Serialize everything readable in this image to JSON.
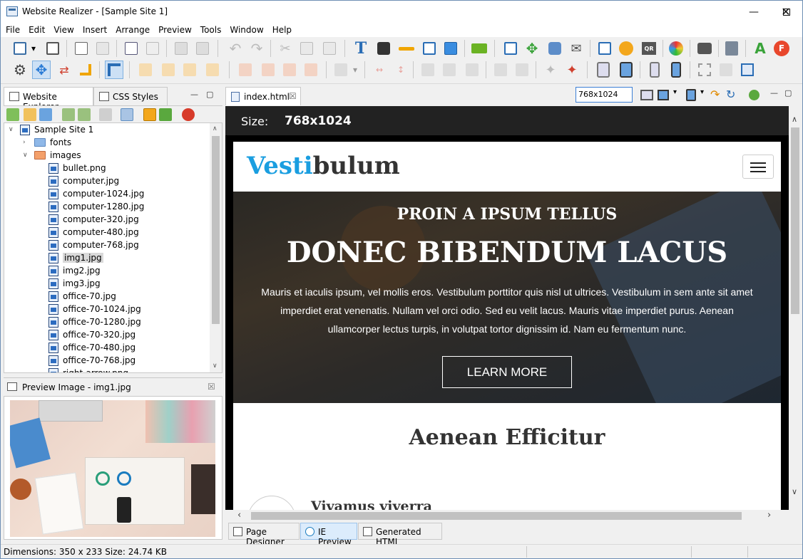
{
  "window": {
    "title": "Website Realizer - [Sample Site 1]"
  },
  "menu": [
    "File",
    "Edit",
    "View",
    "Insert",
    "Arrange",
    "Preview",
    "Tools",
    "Window",
    "Help"
  ],
  "explorer": {
    "tabs": [
      "Website Explorer",
      "CSS Styles"
    ],
    "tree": {
      "root": "Sample Site 1",
      "folders": [
        "fonts",
        "images"
      ],
      "files": [
        "bullet.png",
        "computer.jpg",
        "computer-1024.jpg",
        "computer-1280.jpg",
        "computer-320.jpg",
        "computer-480.jpg",
        "computer-768.jpg",
        "img1.jpg",
        "img2.jpg",
        "img3.jpg",
        "office-70.jpg",
        "office-70-1024.jpg",
        "office-70-1280.jpg",
        "office-70-320.jpg",
        "office-70-480.jpg",
        "office-70-768.jpg",
        "right-arrow.png"
      ],
      "selected": "img1.jpg"
    },
    "preview_title": "Preview Image - img1.jpg"
  },
  "editor": {
    "doc_tab": "index.html",
    "size_value": "768x1024",
    "size_bar_label": "Size:",
    "size_bar_value": "768x1024",
    "bottom_tabs": [
      "Page Designer",
      "IE Preview",
      "Generated HTML"
    ],
    "active_bottom_tab": "IE Preview"
  },
  "site": {
    "logo_part1": "Vesti",
    "logo_part2": "bulum",
    "hero_subtitle": "PROIN A IPSUM TELLUS",
    "hero_title": "DONEC BIBENDUM LACUS",
    "hero_text_1": "Mauris et iaculis ipsum, vel mollis eros. Vestibulum porttitor quis nisl ut ultrices. Vestibulum in sem ante sit amet",
    "hero_text_2": "imperdiet erat venenatis. Nullam vel orci odio. Sed eu velit lacus. Mauris vitae imperdiet purus. Aenean",
    "hero_text_3": "ullamcorper lectus turpis, in volutpat tortor dignissim id. Nam eu fermentum nunc.",
    "hero_button": "LEARN MORE",
    "section_title": "Aenean Efficitur",
    "item_title": "Vivamus viverra"
  },
  "status": {
    "text": "Dimensions: 350 x 233 Size: 24.74 KB"
  },
  "colors": {
    "logo_blue": "#1a9ee0",
    "selection": "#cce0f5",
    "sizebar_bg": "#222222"
  }
}
